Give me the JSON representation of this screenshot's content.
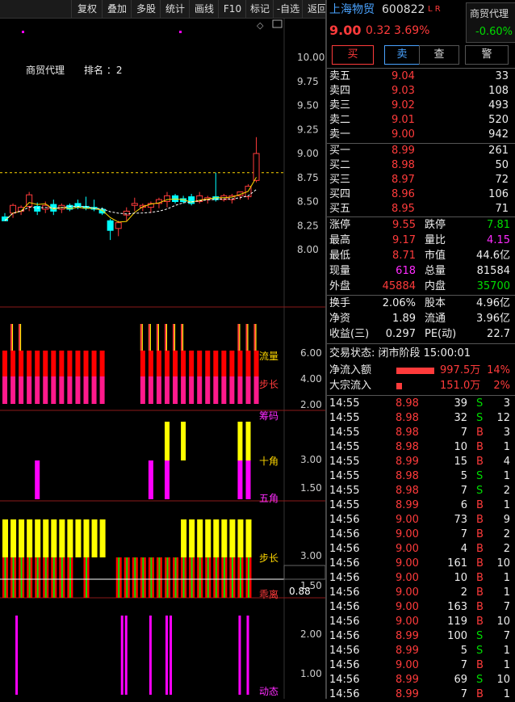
{
  "toolbar": {
    "items": [
      "复权",
      "叠加",
      "多股",
      "统计",
      "画线",
      "F10",
      "标记",
      "-自选",
      "返回"
    ]
  },
  "main_chart": {
    "sector_label": "商贸代理",
    "rank_label": "排名 ：2",
    "y_ticks": [
      "10.00",
      "9.75",
      "9.50",
      "9.25",
      "9.00",
      "8.75",
      "8.50",
      "8.25",
      "8.00"
    ],
    "candles": [
      {
        "o": 8.34,
        "h": 8.38,
        "l": 8.3,
        "c": 8.3
      },
      {
        "o": 8.38,
        "h": 8.48,
        "l": 8.33,
        "c": 8.46
      },
      {
        "o": 8.4,
        "h": 8.46,
        "l": 8.36,
        "c": 8.44
      },
      {
        "o": 8.45,
        "h": 8.6,
        "l": 8.4,
        "c": 8.57
      },
      {
        "o": 8.45,
        "h": 8.49,
        "l": 8.36,
        "c": 8.4
      },
      {
        "o": 8.42,
        "h": 8.5,
        "l": 8.38,
        "c": 8.46
      },
      {
        "o": 8.47,
        "h": 8.52,
        "l": 8.36,
        "c": 8.4
      },
      {
        "o": 8.42,
        "h": 8.48,
        "l": 8.38,
        "c": 8.46
      },
      {
        "o": 8.46,
        "h": 8.48,
        "l": 8.4,
        "c": 8.42
      },
      {
        "o": 8.48,
        "h": 8.52,
        "l": 8.42,
        "c": 8.44
      },
      {
        "o": 8.45,
        "h": 8.55,
        "l": 8.41,
        "c": 8.43
      },
      {
        "o": 8.44,
        "h": 8.52,
        "l": 8.4,
        "c": 8.42
      },
      {
        "o": 8.42,
        "h": 8.44,
        "l": 8.36,
        "c": 8.38
      },
      {
        "o": 8.3,
        "h": 8.32,
        "l": 8.1,
        "c": 8.2
      },
      {
        "o": 8.22,
        "h": 8.3,
        "l": 8.14,
        "c": 8.28
      },
      {
        "o": 8.36,
        "h": 8.44,
        "l": 8.3,
        "c": 8.4
      },
      {
        "o": 8.46,
        "h": 8.54,
        "l": 8.4,
        "c": 8.48
      },
      {
        "o": 8.44,
        "h": 8.48,
        "l": 8.4,
        "c": 8.46
      },
      {
        "o": 8.44,
        "h": 8.5,
        "l": 8.38,
        "c": 8.48
      },
      {
        "o": 8.48,
        "h": 8.54,
        "l": 8.43,
        "c": 8.52
      },
      {
        "o": 8.5,
        "h": 8.6,
        "l": 8.44,
        "c": 8.56
      },
      {
        "o": 8.56,
        "h": 8.58,
        "l": 8.48,
        "c": 8.5
      },
      {
        "o": 8.53,
        "h": 8.56,
        "l": 8.48,
        "c": 8.5
      },
      {
        "o": 8.55,
        "h": 8.58,
        "l": 8.46,
        "c": 8.48
      },
      {
        "o": 8.5,
        "h": 8.6,
        "l": 8.48,
        "c": 8.56
      },
      {
        "o": 8.52,
        "h": 8.56,
        "l": 8.48,
        "c": 8.54
      },
      {
        "o": 8.55,
        "h": 8.8,
        "l": 8.5,
        "c": 8.52
      },
      {
        "o": 8.52,
        "h": 8.58,
        "l": 8.5,
        "c": 8.56
      },
      {
        "o": 8.52,
        "h": 8.58,
        "l": 8.48,
        "c": 8.56
      },
      {
        "o": 8.56,
        "h": 8.6,
        "l": 8.52,
        "c": 8.6
      },
      {
        "o": 8.55,
        "h": 8.68,
        "l": 8.52,
        "c": 8.66
      },
      {
        "o": 8.72,
        "h": 9.17,
        "l": 8.7,
        "c": 9.0
      }
    ],
    "ref_line": 8.8
  },
  "indicators": {
    "p1": {
      "labels": [
        "流量",
        "步长",
        "筹码"
      ],
      "ticks": [
        "6.00",
        "4.00",
        "2.00"
      ]
    },
    "p2": {
      "labels": [
        "十角",
        "五角"
      ],
      "ticks": [
        "3.00",
        "1.50"
      ]
    },
    "p3": {
      "labels": [
        "步长",
        "乖离"
      ],
      "ticks": [
        "3.00",
        "1.50"
      ],
      "value": "0.88"
    },
    "p4": {
      "labels": [
        "动态"
      ],
      "ticks": [
        "2.00",
        "1.00"
      ]
    }
  },
  "quote": {
    "name": "上海物贸",
    "code": "600822",
    "flags": "L R",
    "price": "9.00",
    "change": "0.32",
    "change_pct": "3.69%",
    "sector": "商贸代理",
    "sector_pct": "-0.60%",
    "buttons": [
      "买",
      "卖",
      "查",
      "警"
    ],
    "asks": [
      {
        "label": "卖五",
        "price": "9.04",
        "vol": "33"
      },
      {
        "label": "卖四",
        "price": "9.03",
        "vol": "108"
      },
      {
        "label": "卖三",
        "price": "9.02",
        "vol": "493"
      },
      {
        "label": "卖二",
        "price": "9.01",
        "vol": "520"
      },
      {
        "label": "卖一",
        "price": "9.00",
        "vol": "942"
      }
    ],
    "bids": [
      {
        "label": "买一",
        "price": "8.99",
        "vol": "261"
      },
      {
        "label": "买二",
        "price": "8.98",
        "vol": "50"
      },
      {
        "label": "买三",
        "price": "8.97",
        "vol": "72"
      },
      {
        "label": "买四",
        "price": "8.96",
        "vol": "106"
      },
      {
        "label": "买五",
        "price": "8.95",
        "vol": "71"
      }
    ],
    "stats": [
      {
        "l1": "涨停",
        "v1": "9.55",
        "c1": "red",
        "l2": "跌停",
        "v2": "7.81",
        "c2": "green"
      },
      {
        "l1": "最高",
        "v1": "9.17",
        "c1": "red",
        "l2": "量比",
        "v2": "4.15",
        "c2": "magenta"
      },
      {
        "l1": "最低",
        "v1": "8.71",
        "c1": "red",
        "l2": "市值",
        "v2": "44.6亿",
        "c2": "white"
      },
      {
        "l1": "现量",
        "v1": "618",
        "c1": "magenta",
        "l2": "总量",
        "v2": "81584",
        "c2": "white"
      },
      {
        "l1": "外盘",
        "v1": "45884",
        "c1": "red",
        "l2": "内盘",
        "v2": "35700",
        "c2": "green"
      }
    ],
    "fund": [
      {
        "l1": "换手",
        "v1": "2.06%",
        "l2": "股本",
        "v2": "4.96亿"
      },
      {
        "l1": "净资",
        "v1": "1.89",
        "l2": "流通",
        "v2": "3.96亿"
      },
      {
        "l1": "收益(三)",
        "v1": "0.297",
        "l2": "PE(动)",
        "v2": "22.7"
      }
    ],
    "status": "交易状态: 闭市阶段 15:00:01",
    "flows": [
      {
        "label": "净流入额",
        "value": "997.5万",
        "pct": "14%",
        "frac": 0.85
      },
      {
        "label": "大宗流入",
        "value": "151.0万",
        "pct": "2%",
        "frac": 0.12
      }
    ],
    "ticks": [
      {
        "t": "14:55",
        "p": "8.98",
        "v": "39",
        "d": "S",
        "n": "3"
      },
      {
        "t": "14:55",
        "p": "8.98",
        "v": "32",
        "d": "S",
        "n": "12"
      },
      {
        "t": "14:55",
        "p": "8.98",
        "v": "7",
        "d": "B",
        "n": "3"
      },
      {
        "t": "14:55",
        "p": "8.98",
        "v": "10",
        "d": "B",
        "n": "1"
      },
      {
        "t": "14:55",
        "p": "8.99",
        "v": "15",
        "d": "B",
        "n": "4"
      },
      {
        "t": "14:55",
        "p": "8.98",
        "v": "5",
        "d": "S",
        "n": "1"
      },
      {
        "t": "14:55",
        "p": "8.98",
        "v": "7",
        "d": "S",
        "n": "2"
      },
      {
        "t": "14:55",
        "p": "8.99",
        "v": "6",
        "d": "B",
        "n": "1"
      },
      {
        "t": "14:56",
        "p": "9.00",
        "v": "73",
        "d": "B",
        "n": "9"
      },
      {
        "t": "14:56",
        "p": "9.00",
        "v": "7",
        "d": "B",
        "n": "2"
      },
      {
        "t": "14:56",
        "p": "9.00",
        "v": "4",
        "d": "B",
        "n": "2"
      },
      {
        "t": "14:56",
        "p": "9.00",
        "v": "161",
        "d": "B",
        "n": "10"
      },
      {
        "t": "14:56",
        "p": "9.00",
        "v": "10",
        "d": "B",
        "n": "1"
      },
      {
        "t": "14:56",
        "p": "9.00",
        "v": "2",
        "d": "B",
        "n": "1"
      },
      {
        "t": "14:56",
        "p": "9.00",
        "v": "163",
        "d": "B",
        "n": "7"
      },
      {
        "t": "14:56",
        "p": "9.00",
        "v": "119",
        "d": "B",
        "n": "10"
      },
      {
        "t": "14:56",
        "p": "8.99",
        "v": "100",
        "d": "S",
        "n": "7"
      },
      {
        "t": "14:56",
        "p": "8.99",
        "v": "5",
        "d": "S",
        "n": "1"
      },
      {
        "t": "14:56",
        "p": "9.00",
        "v": "7",
        "d": "B",
        "n": "1"
      },
      {
        "t": "14:56",
        "p": "8.99",
        "v": "69",
        "d": "S",
        "n": "10"
      },
      {
        "t": "14:56",
        "p": "8.99",
        "v": "7",
        "d": "B",
        "n": "1"
      }
    ]
  },
  "colors": {
    "up": "#ff3b3b",
    "down": "#00ffff",
    "yellow": "#ffff00",
    "magenta": "#ff00ff",
    "pink": "#ff1a8c",
    "green": "#00e000"
  }
}
